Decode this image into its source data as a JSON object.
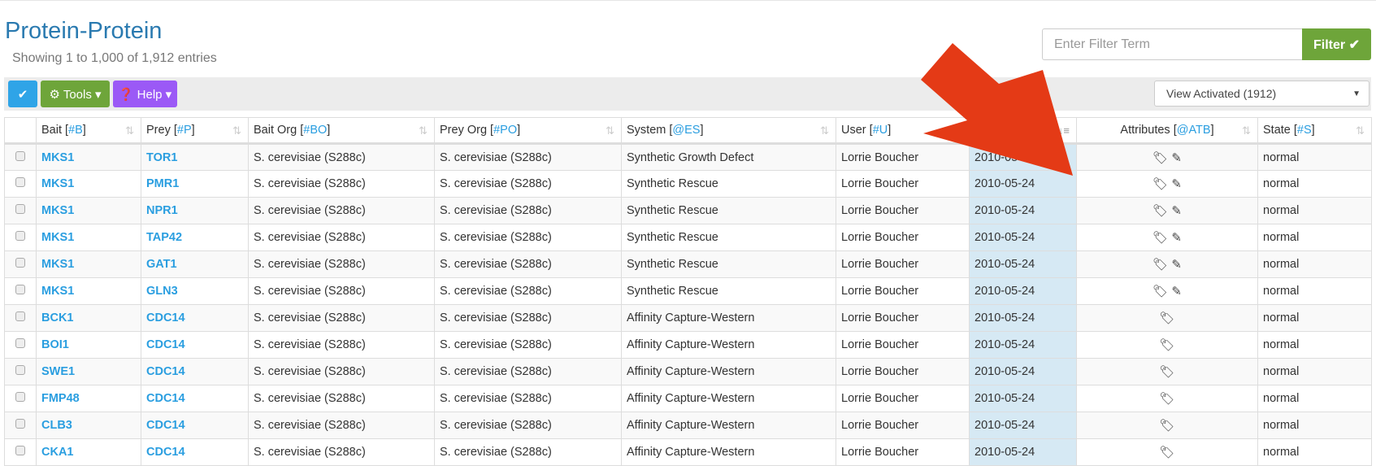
{
  "page": {
    "title": "Protein-Protein",
    "subtitle": "Showing 1 to 1,000 of 1,912 entries"
  },
  "filter": {
    "placeholder": "Enter Filter Term",
    "button": "Filter ✔"
  },
  "toolbar": {
    "check": "✔",
    "tools": "⚙ Tools ▾",
    "help": "❓ Help ▾",
    "view_select": "View Activated (1912)"
  },
  "colors": {
    "check": "#2fa4e7",
    "tools": "#6ea53a",
    "help": "#9b59f6",
    "arrow": "#e43a16"
  },
  "columns": [
    {
      "label": "Bait ",
      "code": "#B"
    },
    {
      "label": "Prey ",
      "code": "#P"
    },
    {
      "label": "Bait Org ",
      "code": "#BO"
    },
    {
      "label": "Prey Org ",
      "code": "#PO"
    },
    {
      "label": "System ",
      "code": "@ES"
    },
    {
      "label": "User ",
      "code": "#U"
    },
    {
      "label": "",
      "code": ""
    },
    {
      "label": "Attributes ",
      "code": "@ATB"
    },
    {
      "label": "State ",
      "code": "#S"
    }
  ],
  "rows": [
    {
      "bait": "MKS1",
      "prey": "TOR1",
      "bo": "S. cerevisiae (S288c)",
      "po": "S. cerevisiae (S288c)",
      "sys": "Synthetic Growth Defect",
      "user": "Lorrie Boucher",
      "date": "2010-05-24",
      "attr": "🏷 ✎",
      "state": "normal"
    },
    {
      "bait": "MKS1",
      "prey": "PMR1",
      "bo": "S. cerevisiae (S288c)",
      "po": "S. cerevisiae (S288c)",
      "sys": "Synthetic Rescue",
      "user": "Lorrie Boucher",
      "date": "2010-05-24",
      "attr": "🏷 ✎",
      "state": "normal"
    },
    {
      "bait": "MKS1",
      "prey": "NPR1",
      "bo": "S. cerevisiae (S288c)",
      "po": "S. cerevisiae (S288c)",
      "sys": "Synthetic Rescue",
      "user": "Lorrie Boucher",
      "date": "2010-05-24",
      "attr": "🏷 ✎",
      "state": "normal"
    },
    {
      "bait": "MKS1",
      "prey": "TAP42",
      "bo": "S. cerevisiae (S288c)",
      "po": "S. cerevisiae (S288c)",
      "sys": "Synthetic Rescue",
      "user": "Lorrie Boucher",
      "date": "2010-05-24",
      "attr": "🏷 ✎",
      "state": "normal"
    },
    {
      "bait": "MKS1",
      "prey": "GAT1",
      "bo": "S. cerevisiae (S288c)",
      "po": "S. cerevisiae (S288c)",
      "sys": "Synthetic Rescue",
      "user": "Lorrie Boucher",
      "date": "2010-05-24",
      "attr": "🏷 ✎",
      "state": "normal"
    },
    {
      "bait": "MKS1",
      "prey": "GLN3",
      "bo": "S. cerevisiae (S288c)",
      "po": "S. cerevisiae (S288c)",
      "sys": "Synthetic Rescue",
      "user": "Lorrie Boucher",
      "date": "2010-05-24",
      "attr": "🏷 ✎",
      "state": "normal"
    },
    {
      "bait": "BCK1",
      "prey": "CDC14",
      "bo": "S. cerevisiae (S288c)",
      "po": "S. cerevisiae (S288c)",
      "sys": "Affinity Capture-Western",
      "user": "Lorrie Boucher",
      "date": "2010-05-24",
      "attr": "🏷",
      "state": "normal"
    },
    {
      "bait": "BOI1",
      "prey": "CDC14",
      "bo": "S. cerevisiae (S288c)",
      "po": "S. cerevisiae (S288c)",
      "sys": "Affinity Capture-Western",
      "user": "Lorrie Boucher",
      "date": "2010-05-24",
      "attr": "🏷",
      "state": "normal"
    },
    {
      "bait": "SWE1",
      "prey": "CDC14",
      "bo": "S. cerevisiae (S288c)",
      "po": "S. cerevisiae (S288c)",
      "sys": "Affinity Capture-Western",
      "user": "Lorrie Boucher",
      "date": "2010-05-24",
      "attr": "🏷",
      "state": "normal"
    },
    {
      "bait": "FMP48",
      "prey": "CDC14",
      "bo": "S. cerevisiae (S288c)",
      "po": "S. cerevisiae (S288c)",
      "sys": "Affinity Capture-Western",
      "user": "Lorrie Boucher",
      "date": "2010-05-24",
      "attr": "🏷",
      "state": "normal"
    },
    {
      "bait": "CLB3",
      "prey": "CDC14",
      "bo": "S. cerevisiae (S288c)",
      "po": "S. cerevisiae (S288c)",
      "sys": "Affinity Capture-Western",
      "user": "Lorrie Boucher",
      "date": "2010-05-24",
      "attr": "🏷",
      "state": "normal"
    },
    {
      "bait": "CKA1",
      "prey": "CDC14",
      "bo": "S. cerevisiae (S288c)",
      "po": "S. cerevisiae (S288c)",
      "sys": "Affinity Capture-Western",
      "user": "Lorrie Boucher",
      "date": "2010-05-24",
      "attr": "🏷",
      "state": "normal"
    }
  ]
}
